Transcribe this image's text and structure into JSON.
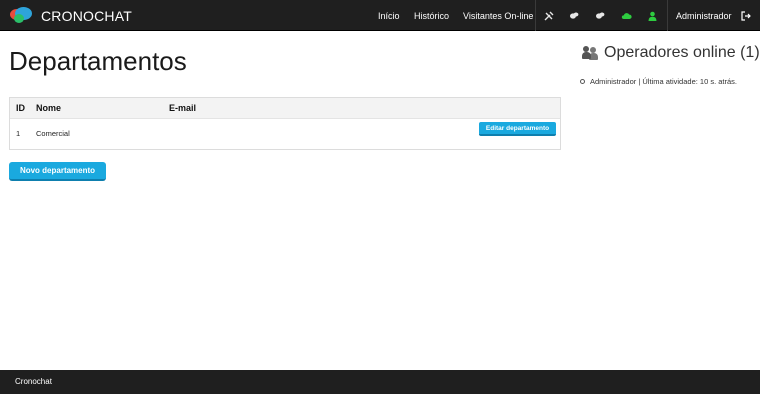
{
  "app": {
    "brand": "CRONOCHAT"
  },
  "nav": {
    "links": [
      "Início",
      "Histórico",
      "Visitantes On-line"
    ],
    "icons": [
      "tools-icon",
      "chat-bubble-icon",
      "chat-bubble-alt-icon",
      "cloud-icon",
      "user-icon"
    ],
    "icon_colors": {
      "cloud": "#2ecc40",
      "user": "#2ecc40"
    },
    "user": "Administrador"
  },
  "main": {
    "title": "Departamentos",
    "table": {
      "headers": [
        "ID",
        "Nome",
        "E-mail"
      ],
      "rows": [
        {
          "id": "1",
          "nome": "Comercial",
          "email": "",
          "action": "Editar departamento"
        }
      ]
    },
    "new_button": "Novo departamento"
  },
  "sidebar": {
    "title": "Operadores online (1)",
    "operators": [
      "Administrador | Última atividade: 10 s. atrás."
    ]
  },
  "footer": {
    "text": "Cronochat"
  },
  "colors": {
    "navbar": "#1f1f1f",
    "accent": "#1aa9df",
    "status_online": "#2ecc40"
  }
}
